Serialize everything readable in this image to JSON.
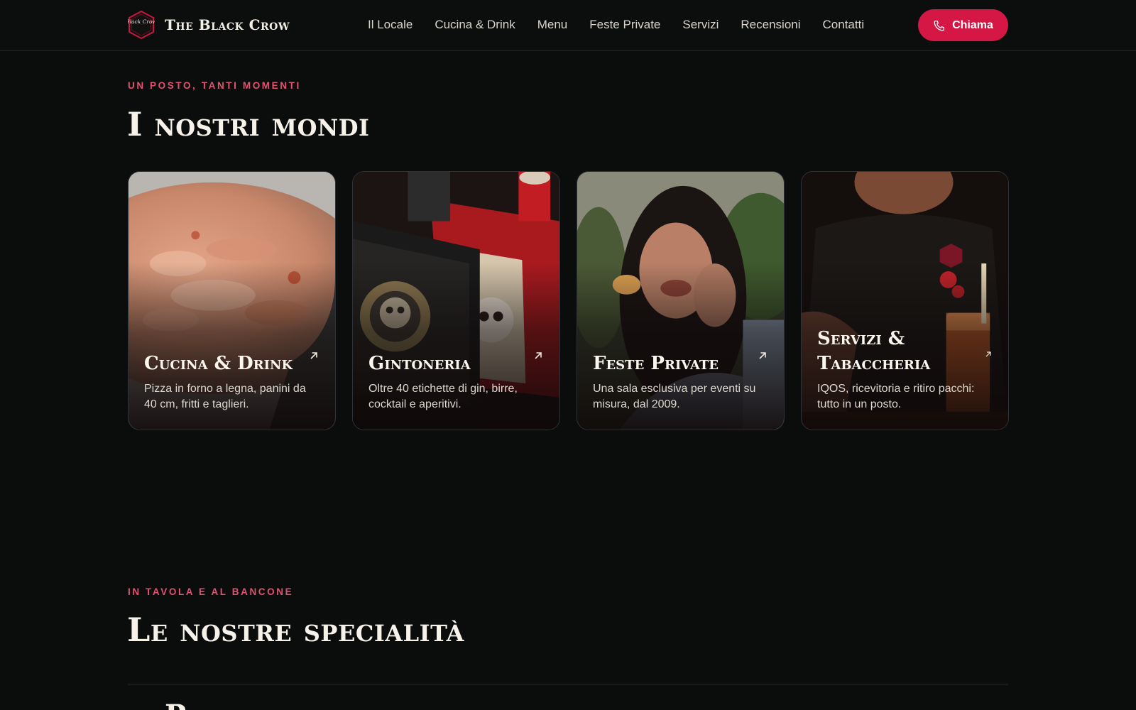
{
  "brand": {
    "logo_text": "Black Crow",
    "name": "The Black Crow"
  },
  "nav": {
    "items": [
      {
        "label": "Il Locale"
      },
      {
        "label": "Cucina & Drink"
      },
      {
        "label": "Menu"
      },
      {
        "label": "Feste Private"
      },
      {
        "label": "Servizi"
      },
      {
        "label": "Recensioni"
      },
      {
        "label": "Contatti"
      }
    ],
    "call_label": "Chiama",
    "call_icon": "phone-icon"
  },
  "worlds": {
    "eyebrow": "Un posto, tanti momenti",
    "title": "I nostri mondi",
    "cards": [
      {
        "title": "Cucina & Drink",
        "desc": "Pizza in forno a legna, panini da 40 cm, fritti e taglieri.",
        "icon": "arrow-up-right-icon"
      },
      {
        "title": "Gintoneria",
        "desc": "Oltre 40 etichette di gin, birre, cocktail e aperitivi.",
        "icon": "arrow-up-right-icon"
      },
      {
        "title": "Feste Private",
        "desc": "Una sala esclusiva per eventi su misura, dal 2009.",
        "icon": "arrow-up-right-icon"
      },
      {
        "title": "Servizi & Tabaccheria",
        "desc": "IQOS, ricevitoria e ritiro pacchi: tutto in un posto.",
        "icon": "arrow-up-right-icon"
      }
    ]
  },
  "specialties": {
    "eyebrow": "In tavola e al bancone",
    "title": "Le nostre specialità",
    "first_item": "Pizza in forno a legna"
  },
  "colors": {
    "accent": "#d41745",
    "eyebrow": "#e25270",
    "background": "#0b0d0d"
  }
}
